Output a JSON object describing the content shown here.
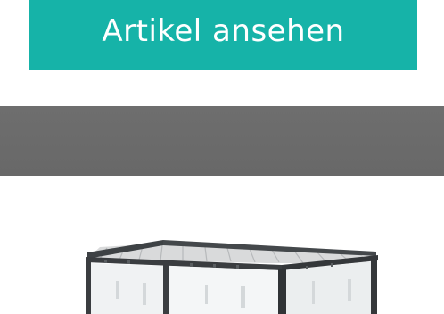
{
  "cta": {
    "label": "Artikel ansehen",
    "background": "#16b3a8",
    "text_color": "#ffffff"
  },
  "band": {
    "color": "#6b6b6b"
  },
  "product_image": {
    "subject": "pergola",
    "frame_color": "#3e4245"
  }
}
